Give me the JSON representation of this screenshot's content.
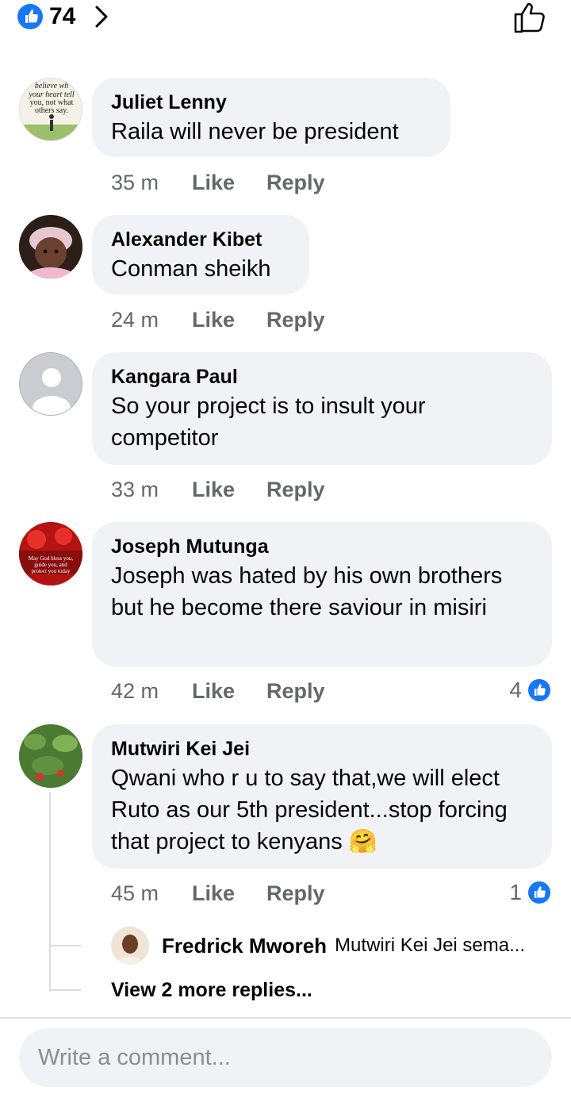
{
  "reactions_header": {
    "count": "74",
    "icon": "like-icon"
  },
  "comments": [
    {
      "author": "Juliet Lenny",
      "text": "Raila will never be president",
      "time": "35 m",
      "like": "Like",
      "reply": "Reply",
      "avatar": {
        "type": "quote",
        "lines": [
          "believe wh",
          "your heart tell",
          "you, not what",
          "others say."
        ]
      }
    },
    {
      "author": "Alexander Kibet",
      "text": "Conman sheikh",
      "time": "24 m",
      "like": "Like",
      "reply": "Reply"
    },
    {
      "author": "Kangara Paul",
      "text": "So your project is to insult your competitor",
      "time": "33 m",
      "like": "Like",
      "reply": "Reply"
    },
    {
      "author": "Joseph Mutunga",
      "text": "Joseph was hated by his own brothers but he become there saviour in misiri",
      "time": "42 m",
      "like": "Like",
      "reply": "Reply",
      "reactions": "4",
      "avatar": {
        "type": "flowers",
        "lines": [
          "May God bless you,",
          "guide you, and",
          "protect you today"
        ]
      }
    },
    {
      "author": "Mutwiri Kei Jei",
      "text": "Qwani who r u to say that,we will elect Ruto as our 5th president...stop forcing that project to kenyans",
      "emoji": "🤗",
      "time": "45 m",
      "like": "Like",
      "reply": "Reply",
      "reactions": "1"
    }
  ],
  "reply_preview": {
    "author": "Fredrick Mworeh",
    "snippet": "Mutwiri Kei Jei sema..."
  },
  "view_more": "View 2 more replies...",
  "composer": {
    "placeholder": "Write a comment..."
  },
  "colors": {
    "accent": "#1877f2",
    "bubble": "#f0f2f5",
    "muted": "#65676b"
  }
}
